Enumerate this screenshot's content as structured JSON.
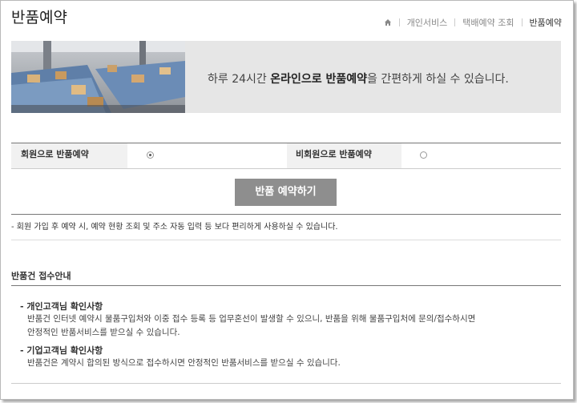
{
  "page": {
    "title": "반품예약"
  },
  "breadcrumb": {
    "home_icon": "home-icon",
    "items": [
      "개인서비스",
      "택배예약 조회",
      "반품예약"
    ]
  },
  "banner": {
    "image": "parcel-conveyor-photo",
    "text_before": "하루 24시간 ",
    "text_bold": "온라인으로 반품예약",
    "text_after": "을 간편하게 하실 수 있습니다."
  },
  "options": {
    "member": {
      "label": "회원으로 반품예약",
      "selected": true
    },
    "guest": {
      "label": "비회원으로 반품예약",
      "selected": false
    }
  },
  "button": {
    "label": "반품 예약하기"
  },
  "note": "- 회원 가입 후 예약 시, 예약 현황 조회 및 주소 자동 입력 등 보다 편리하게 사용하실 수 있습니다.",
  "guide": {
    "title": "반품건 접수안내",
    "personal": {
      "title": "- 개인고객님 확인사항",
      "line1": "반품건 인터넷 예약시 물품구입처와 이중 접수 등록 등 업무혼선이 발생할 수 있으니, 반품을 위해 물품구입처에 문의/접수하시면",
      "line2": "안정적인 반품서비스를 받으실 수 있습니다."
    },
    "business": {
      "title": "- 기업고객님 확인사항",
      "line1": "반품건은 계약시 합의된 방식으로 접수하시면 안정적인 반품서비스를 받으실 수 있습니다."
    }
  },
  "colors": {
    "button_bg": "#8e8e8e",
    "banner_bg": "#e6e6e6",
    "option_label_bg": "#f1f1f1"
  }
}
